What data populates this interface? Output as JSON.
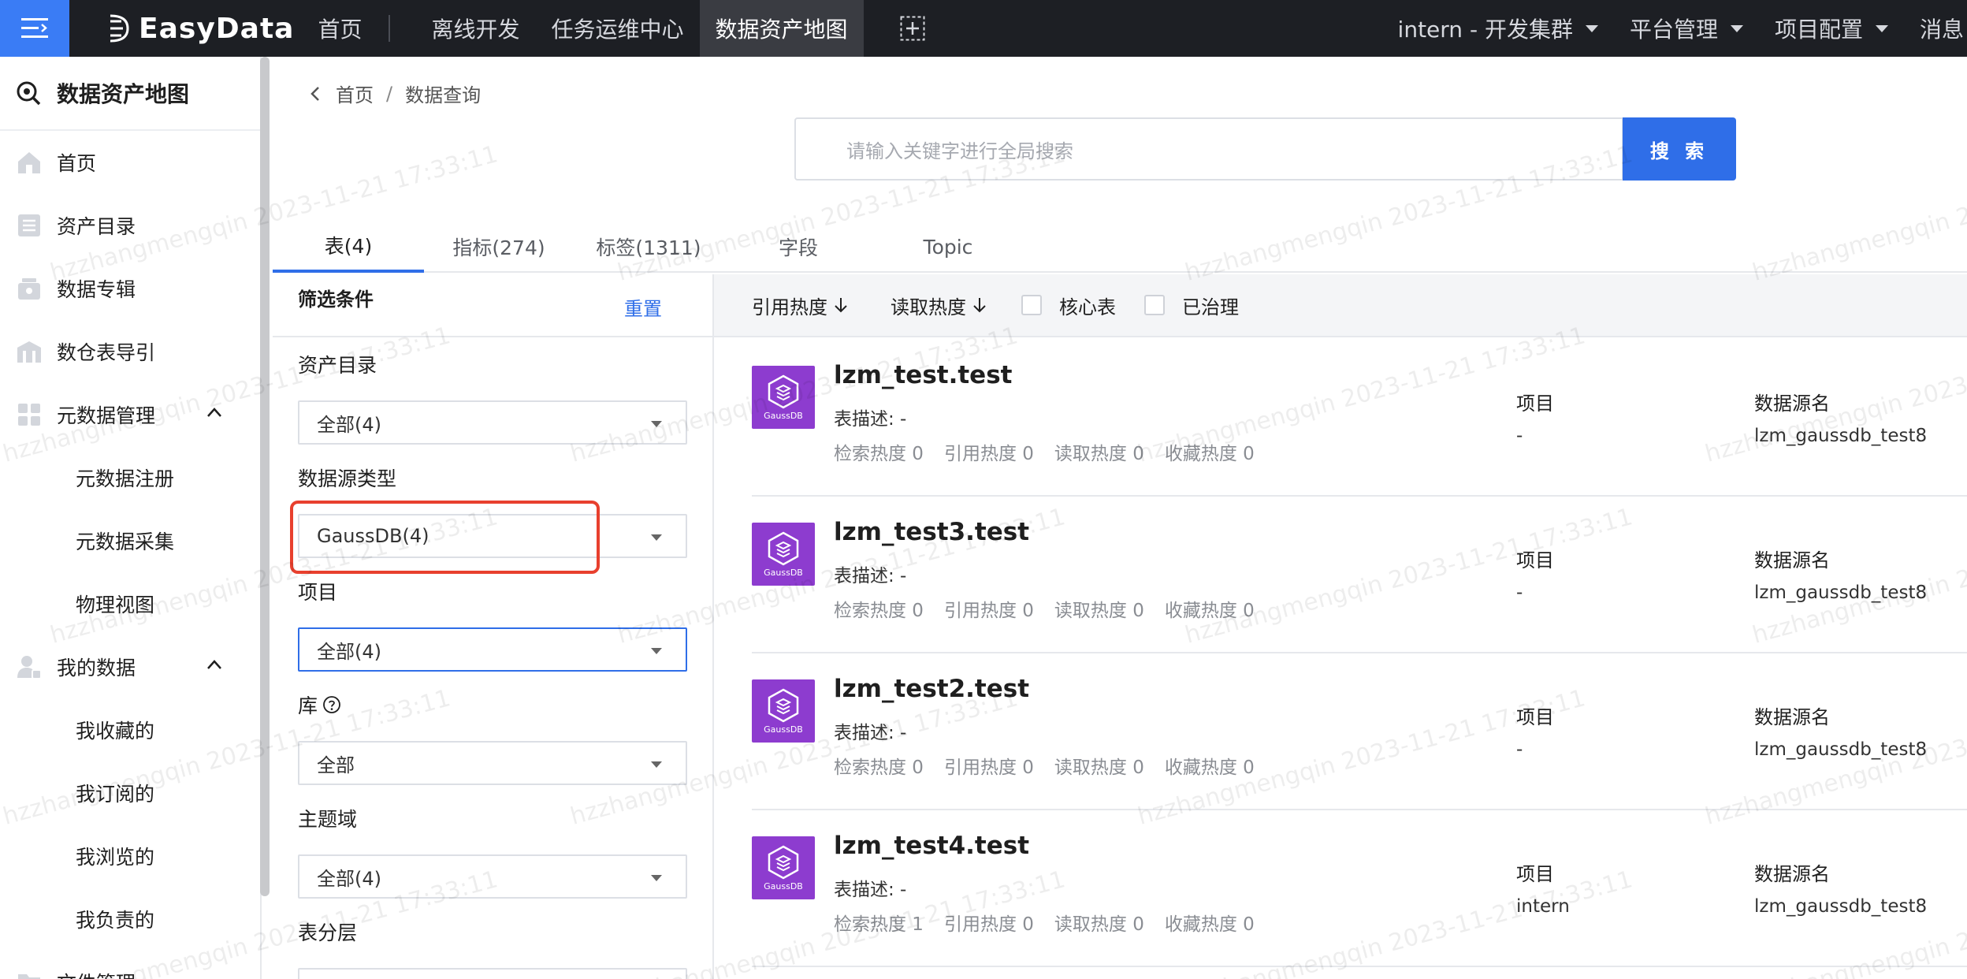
{
  "topbar": {
    "logo": "EasyData",
    "nav": [
      "首页",
      "离线开发",
      "任务运维中心",
      "数据资产地图"
    ],
    "right": [
      "intern - 开发集群",
      "平台管理",
      "项目配置",
      "消息"
    ]
  },
  "sidebar": {
    "title": "数据资产地图",
    "items": [
      {
        "label": "首页"
      },
      {
        "label": "资产目录"
      },
      {
        "label": "数据专辑"
      },
      {
        "label": "数仓表导引"
      },
      {
        "label": "元数据管理"
      },
      {
        "label": "元数据注册"
      },
      {
        "label": "元数据采集"
      },
      {
        "label": "物理视图"
      },
      {
        "label": "我的数据"
      },
      {
        "label": "我收藏的"
      },
      {
        "label": "我订阅的"
      },
      {
        "label": "我浏览的"
      },
      {
        "label": "我负责的"
      },
      {
        "label": "文件管理"
      }
    ]
  },
  "breadcrumb": {
    "home": "首页",
    "sep": "/",
    "current": "数据查询"
  },
  "search": {
    "placeholder": "请输入关键字进行全局搜索",
    "button": "搜 索"
  },
  "tabs": [
    "表(4)",
    "指标(274)",
    "标签(1311)",
    "字段",
    "Topic"
  ],
  "filter": {
    "title": "筛选条件",
    "reset": "重置",
    "groups": [
      {
        "label": "资产目录",
        "value": "全部(4)"
      },
      {
        "label": "数据源类型",
        "value": "GaussDB(4)"
      },
      {
        "label": "项目",
        "value": "全部(4)"
      },
      {
        "label": "库",
        "value": "全部"
      },
      {
        "label": "主题域",
        "value": "全部(4)"
      },
      {
        "label": "表分层",
        "value": ""
      }
    ]
  },
  "sortbar": {
    "sort1": "引用热度",
    "sort2": "读取热度",
    "chk1": "核心表",
    "chk2": "已治理"
  },
  "results": [
    {
      "name": "lzm_test.test",
      "desc": "表描述: -",
      "stats": [
        "检索热度 0",
        "引用热度 0",
        "读取热度 0",
        "收藏热度 0"
      ],
      "proj_label": "项目",
      "proj": "-",
      "src_label": "数据源名",
      "src": "lzm_gaussdb_test8"
    },
    {
      "name": "lzm_test3.test",
      "desc": "表描述: -",
      "stats": [
        "检索热度 0",
        "引用热度 0",
        "读取热度 0",
        "收藏热度 0"
      ],
      "proj_label": "项目",
      "proj": "-",
      "src_label": "数据源名",
      "src": "lzm_gaussdb_test8"
    },
    {
      "name": "lzm_test2.test",
      "desc": "表描述: -",
      "stats": [
        "检索热度 0",
        "引用热度 0",
        "读取热度 0",
        "收藏热度 0"
      ],
      "proj_label": "项目",
      "proj": "-",
      "src_label": "数据源名",
      "src": "lzm_gaussdb_test8"
    },
    {
      "name": "lzm_test4.test",
      "desc": "表描述: -",
      "stats": [
        "检索热度 1",
        "引用热度 0",
        "读取热度 0",
        "收藏热度 0"
      ],
      "proj_label": "项目",
      "proj": "intern",
      "src_label": "数据源名",
      "src": "lzm_gaussdb_test8"
    }
  ],
  "gauss_label": "GaussDB",
  "watermark": "hzzhangmengqin 2023-11-21 17:33:11",
  "colors": {
    "accent": "#2f6ee8",
    "topbar": "#1d1f24",
    "highlight": "#e8402e",
    "gauss": "#8d3ccf"
  }
}
